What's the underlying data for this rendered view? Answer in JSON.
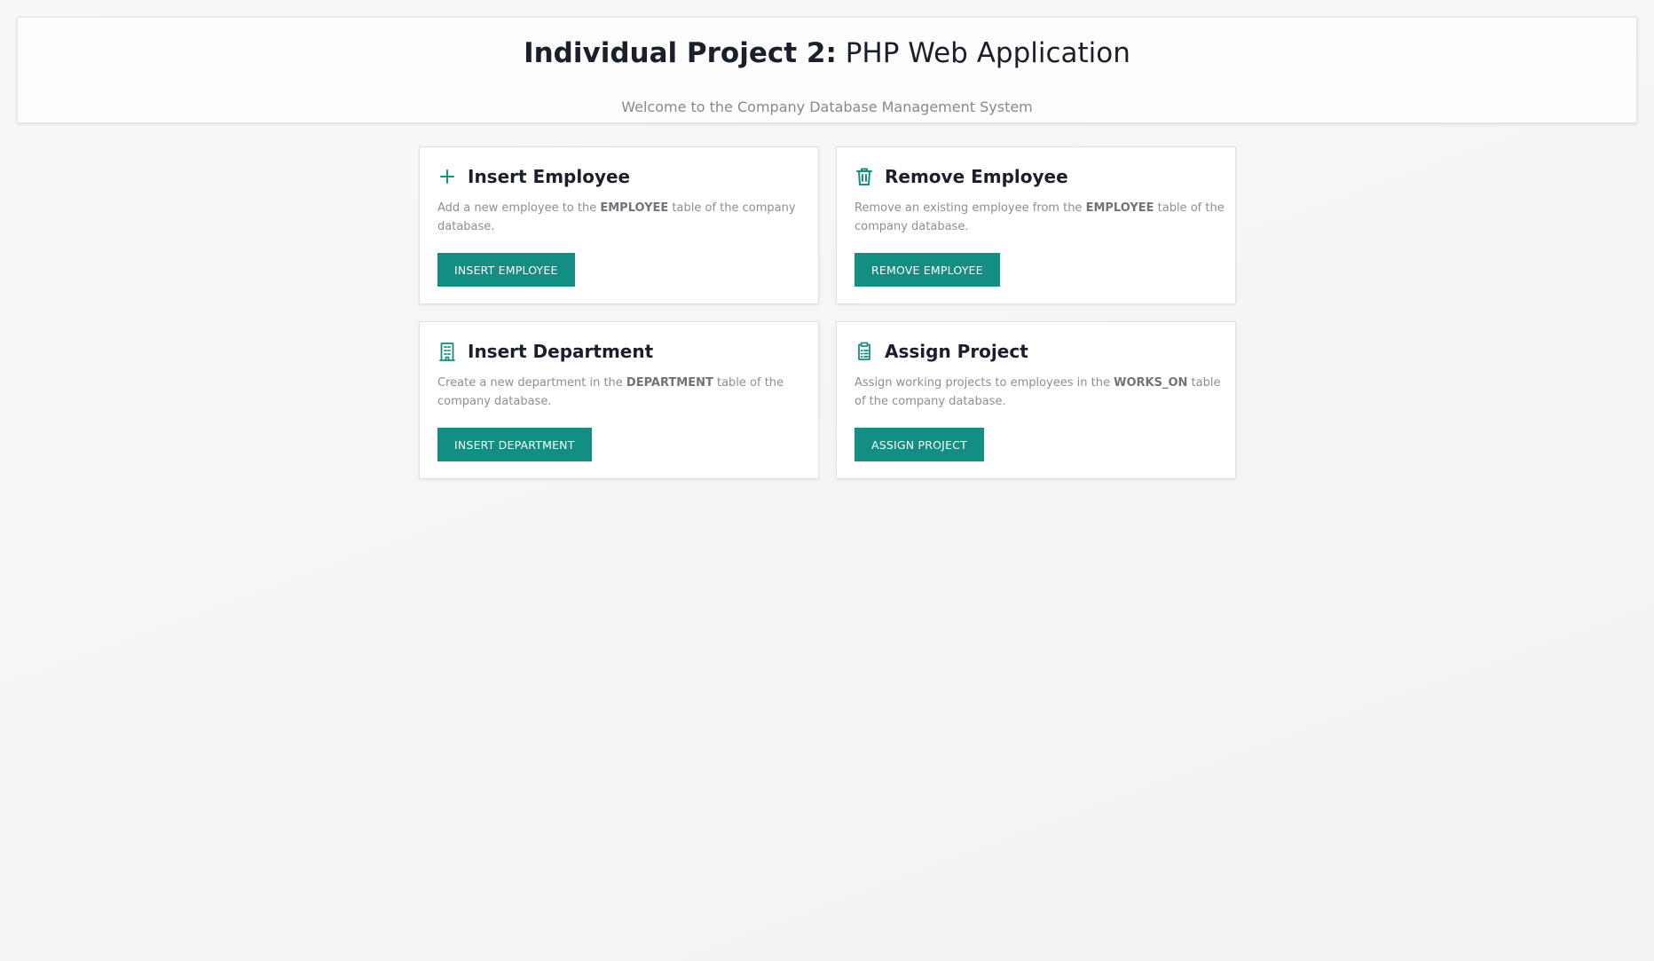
{
  "header": {
    "title_bold": "Individual Project 2:",
    "title_rest": " PHP Web Application",
    "subtitle": "Welcome to the Company Database Management System"
  },
  "accent_color": "#128f82",
  "cards": [
    {
      "icon": "plus-icon",
      "title": "Insert Employee",
      "desc_before": "Add a new employee to the ",
      "desc_table": "EMPLOYEE",
      "desc_after": " table of the company database.",
      "button": "INSERT EMPLOYEE"
    },
    {
      "icon": "trash-icon",
      "title": "Remove Employee",
      "desc_before": "Remove an existing employee from the ",
      "desc_table": "EMPLOYEE",
      "desc_after": " table of the company database.",
      "button": "REMOVE EMPLOYEE"
    },
    {
      "icon": "building-icon",
      "title": "Insert Department",
      "desc_before": "Create a new department in the ",
      "desc_table": "DEPARTMENT",
      "desc_after": " table of the company database.",
      "button": "INSERT DEPARTMENT"
    },
    {
      "icon": "clipboard-icon",
      "title": "Assign Project",
      "desc_before": "Assign working projects to employees in the ",
      "desc_table": "WORKS_ON",
      "desc_after": " table of the company database.",
      "button": "ASSIGN PROJECT"
    }
  ]
}
